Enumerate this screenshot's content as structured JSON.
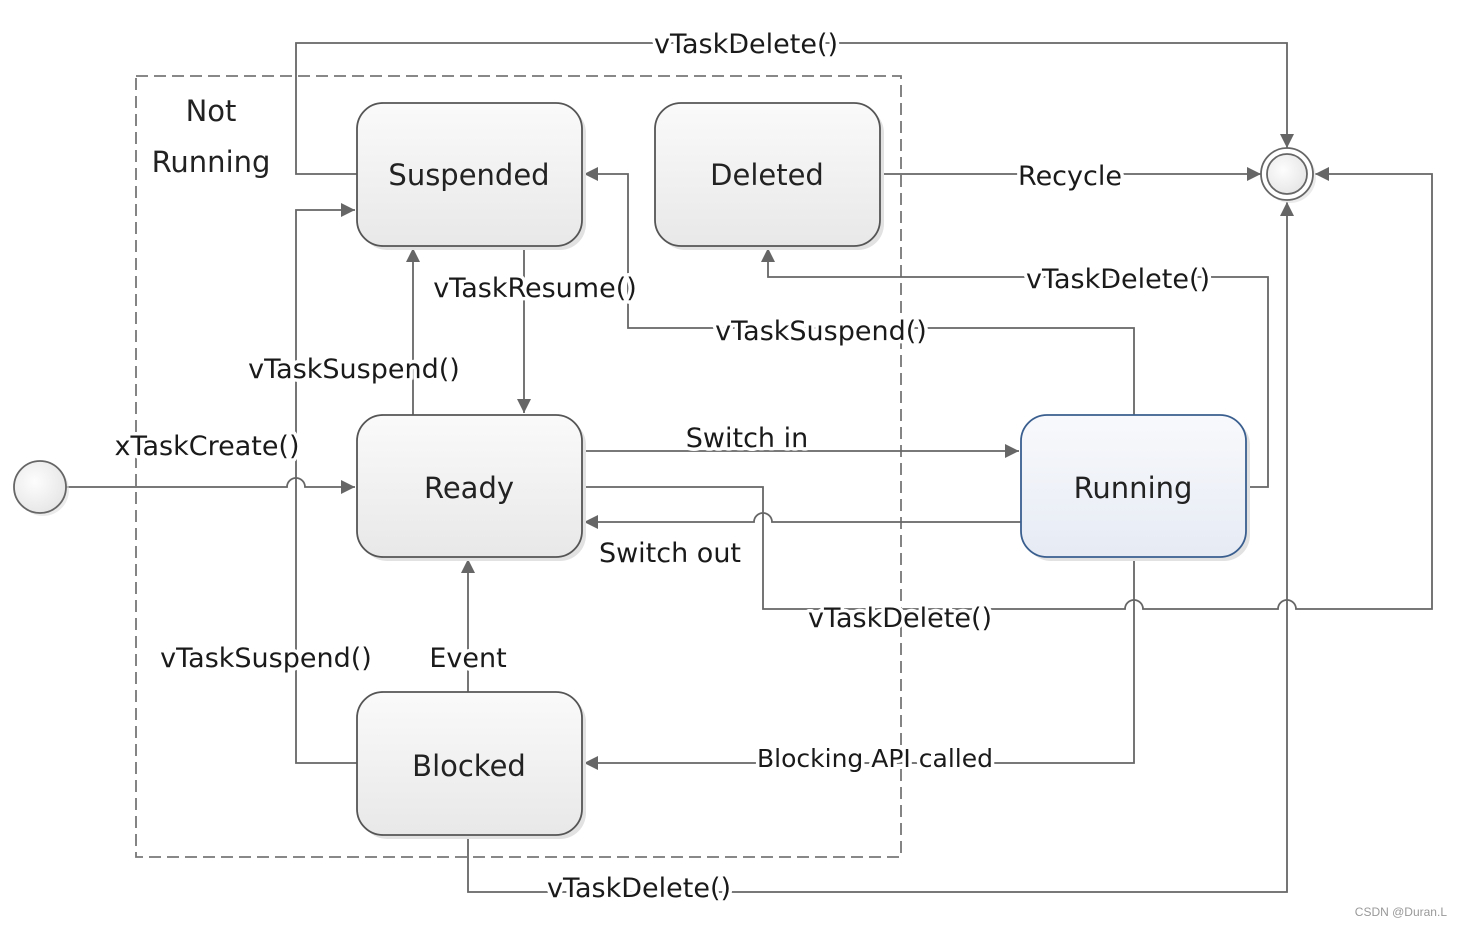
{
  "container": {
    "label_line1": "Not",
    "label_line2": "Running"
  },
  "states": {
    "suspended": "Suspended",
    "deleted": "Deleted",
    "ready": "Ready",
    "blocked": "Blocked",
    "running": "Running"
  },
  "transitions": {
    "suspended_to_end": "vTaskDelete()",
    "deleted_recycle": "Recycle",
    "running_to_deleted": "vTaskDelete()",
    "running_to_suspended": "vTaskSuspend()",
    "ready_to_suspended": "vTaskSuspend()",
    "suspended_to_ready": "vTaskResume()",
    "create": "xTaskCreate()",
    "switch_in": "Switch in",
    "switch_out": "Switch out",
    "ready_to_end": "vTaskDelete()",
    "event": "Event",
    "blocked_to_suspended": "vTaskSuspend()",
    "blocking_api": "Blocking API called",
    "blocked_to_end": "vTaskDelete()"
  },
  "watermark": "CSDN @Duran.L",
  "colors": {
    "edge": "#666666",
    "running_border": "#3a5f8f",
    "state_border": "#555555"
  }
}
